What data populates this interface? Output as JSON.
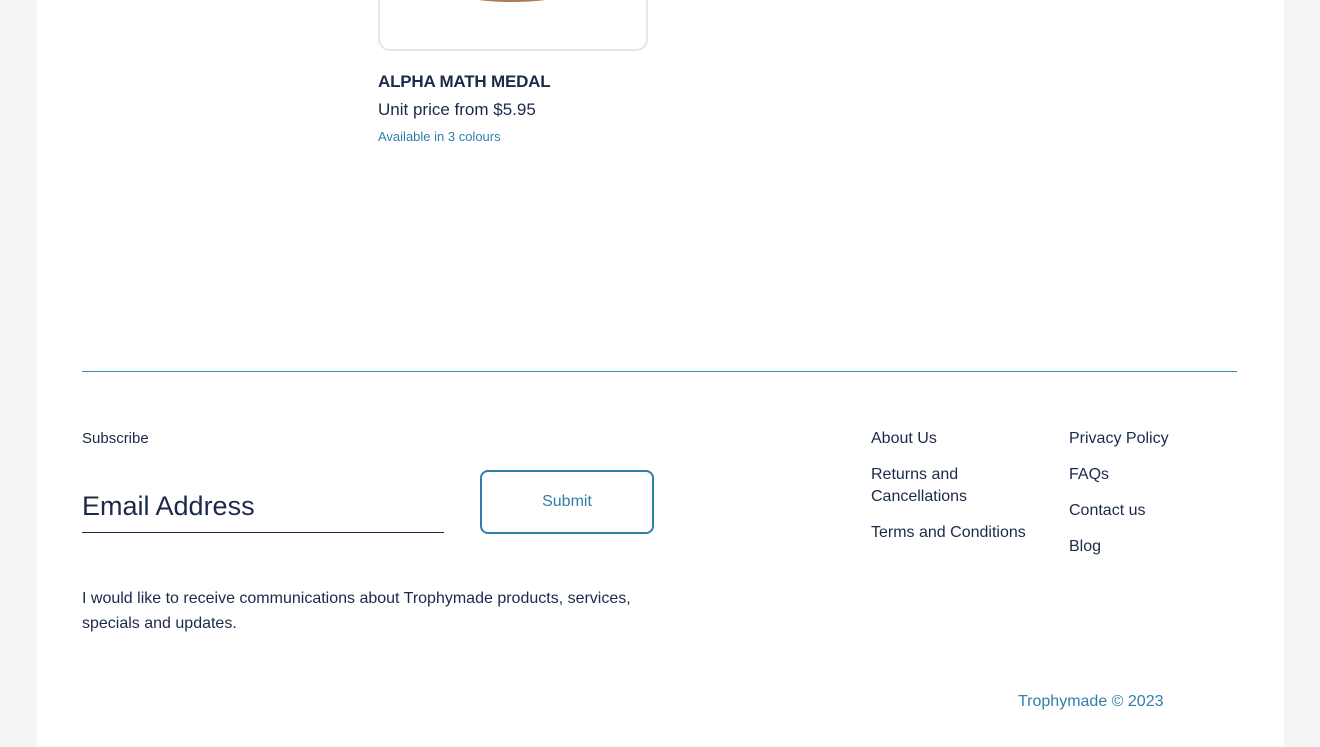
{
  "product": {
    "name": "ALPHA MATH MEDAL",
    "price_label": "Unit price from  $5.95",
    "colours": "Available in 3 colours"
  },
  "footer": {
    "subscribe_label": "Subscribe",
    "email_placeholder": "Email Address",
    "submit_label": "Submit",
    "consent_text": "I would like to receive communications about Trophymade products, services, specials and updates.",
    "links_col1": [
      "About Us",
      "Returns and Cancellations",
      "Terms and Conditions"
    ],
    "links_col2": [
      "Privacy Policy",
      "FAQs",
      "Contact us",
      "Blog"
    ],
    "copyright": "Trophymade © 2023"
  },
  "colors": {
    "accent": "#2f7fab",
    "text": "#1b2a4a",
    "divider": "#2f8fb3"
  }
}
